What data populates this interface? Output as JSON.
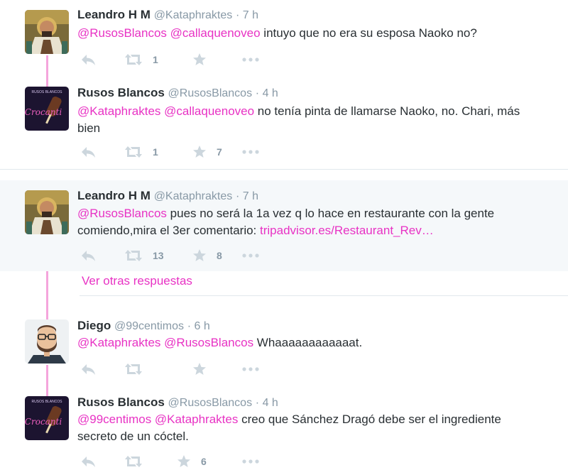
{
  "conversation": {
    "more_replies_label": "Ver otras respuestas",
    "tweets": [
      {
        "fullname": "Leandro H M",
        "username": "@Kataphraktes",
        "time": "· 7 h",
        "mentions": "@RusosBlancos @callaquenoveo",
        "text": " intuyo que no era su esposa Naoko no?",
        "retweets": "1",
        "favorites": ""
      },
      {
        "fullname": "Rusos Blancos",
        "username": "@RusosBlancos",
        "time": "· 4 h",
        "mentions": "@Kataphraktes @callaquenoveo",
        "text": " no tenía pinta de llamarse Naoko, no. Chari, más bien",
        "retweets": "1",
        "favorites": "7"
      },
      {
        "fullname": "Leandro H M",
        "username": "@Kataphraktes",
        "time": "· 7 h",
        "mentions": "@RusosBlancos",
        "text": " pues no será la 1a vez q lo hace en restaurante con la gente comiendo,mira el 3er comentario: ",
        "link": "tripadvisor.es/Restaurant_Rev…",
        "retweets": "13",
        "favorites": "8"
      },
      {
        "fullname": "Diego",
        "username": "@99centimos",
        "time": "· 6 h",
        "mentions": "@Kataphraktes @RusosBlancos",
        "text": " Whaaaaaaaaaaaat.",
        "retweets": "",
        "favorites": ""
      },
      {
        "fullname": "Rusos Blancos",
        "username": "@RusosBlancos",
        "time": "· 4 h",
        "mentions": "@99centimos @Kataphraktes",
        "text": " creo que Sánchez Dragó debe ser el ingrediente secreto de un cóctel.",
        "retweets": "",
        "favorites": "6"
      }
    ]
  },
  "avatars": {
    "leandro": {
      "icon": "mosaic-portrait-avatar",
      "avatar_text": ""
    },
    "rusos": {
      "icon": "crocanti-icecream-avatar",
      "avatar_text": "Crocanti",
      "avatar_top_text": "RUSOS BLANCOS"
    },
    "diego": {
      "icon": "bearded-man-cartoon-avatar"
    }
  },
  "colors": {
    "mention": "#e832c4",
    "thread_line": "#f5a5dc",
    "highlight_bg": "#f5f8fa",
    "meta": "#8899a6",
    "icon": "#ccd6dd"
  }
}
